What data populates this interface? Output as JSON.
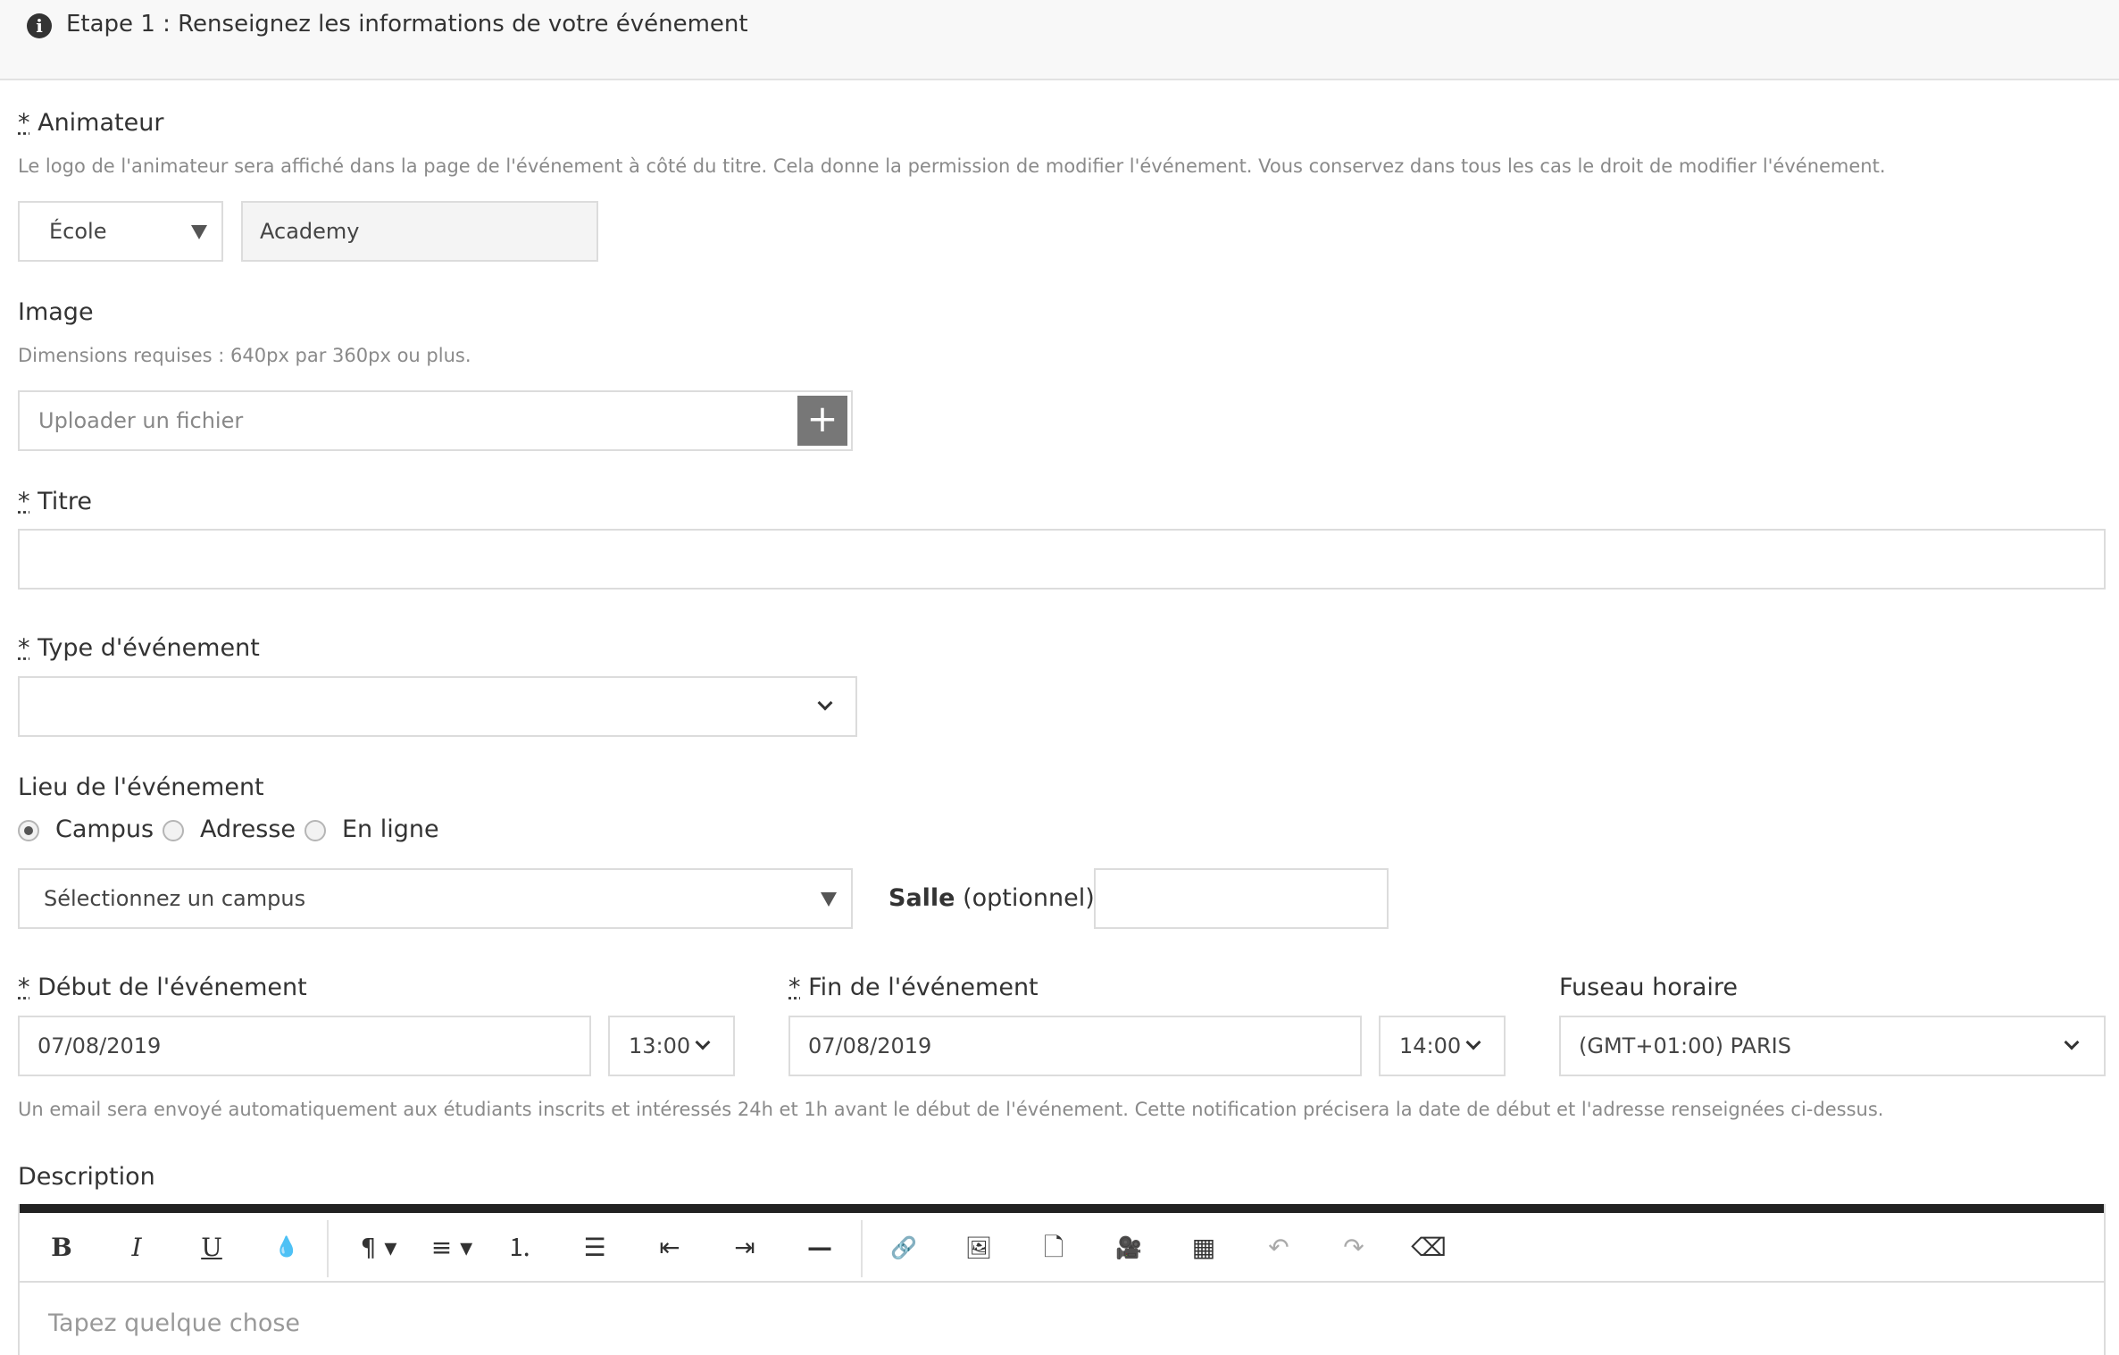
{
  "header": {
    "title": "Etape 1 : Renseignez les informations de votre événement",
    "icon": "info-icon"
  },
  "animateur": {
    "required_mark": "*",
    "label": "Animateur",
    "help": "Le logo de l'animateur sera affiché dans la page de l'événement à côté du titre. Cela donne la permission de modifier l'événement. Vous conservez dans tous les cas le droit de modifier l'événement.",
    "type_value": "École",
    "name_value": "Academy"
  },
  "image": {
    "label": "Image",
    "help": "Dimensions requises : 640px par 360px ou plus.",
    "upload_placeholder": "Uploader un fichier",
    "upload_button": "+"
  },
  "titre": {
    "required_mark": "*",
    "label": "Titre",
    "value": ""
  },
  "type_evenement": {
    "required_mark": "*",
    "label": "Type d'événement",
    "value": ""
  },
  "lieu": {
    "label": "Lieu de l'événement",
    "options": [
      "Campus",
      "Adresse",
      "En ligne"
    ],
    "selected": "Campus",
    "campus_placeholder": "Sélectionnez un campus",
    "salle_label_bold": "Salle",
    "salle_label_rest": " (optionnel) :",
    "salle_value": ""
  },
  "debut": {
    "required_mark": "*",
    "label": "Début de l'événement",
    "date": "07/08/2019",
    "time": "13:00"
  },
  "fin": {
    "required_mark": "*",
    "label": "Fin de l'événement",
    "date": "07/08/2019",
    "time": "14:00"
  },
  "fuseau": {
    "label": "Fuseau horaire",
    "value": "(GMT+01:00) PARIS"
  },
  "notification_help": "Un email sera envoyé automatiquement aux étudiants inscrits et intéressés 24h et 1h avant le début de l'événement. Cette notification précisera la date de début et l'adresse renseignées ci-dessus.",
  "description": {
    "label": "Description",
    "placeholder": "Tapez quelque chose",
    "toolbar": [
      {
        "name": "bold-icon",
        "glyph": "B"
      },
      {
        "name": "italic-icon",
        "glyph": "I"
      },
      {
        "name": "underline-icon",
        "glyph": "U"
      },
      {
        "name": "text-color-icon",
        "glyph": "💧"
      },
      {
        "name": "paragraph-format-icon",
        "glyph": "¶ ▾"
      },
      {
        "name": "align-icon",
        "glyph": "≡ ▾"
      },
      {
        "name": "ordered-list-icon",
        "glyph": "⒈"
      },
      {
        "name": "unordered-list-icon",
        "glyph": "☰"
      },
      {
        "name": "outdent-icon",
        "glyph": "⇤"
      },
      {
        "name": "indent-icon",
        "glyph": "⇥"
      },
      {
        "name": "horizontal-rule-icon",
        "glyph": "—"
      },
      {
        "name": "link-icon",
        "glyph": "🔗"
      },
      {
        "name": "image-icon",
        "glyph": "🖼"
      },
      {
        "name": "file-icon",
        "glyph": "🗋"
      },
      {
        "name": "video-icon",
        "glyph": "🎥"
      },
      {
        "name": "table-icon",
        "glyph": "▦"
      },
      {
        "name": "undo-icon",
        "glyph": "↶"
      },
      {
        "name": "redo-icon",
        "glyph": "↷"
      },
      {
        "name": "clear-format-icon",
        "glyph": "⌫"
      }
    ]
  }
}
